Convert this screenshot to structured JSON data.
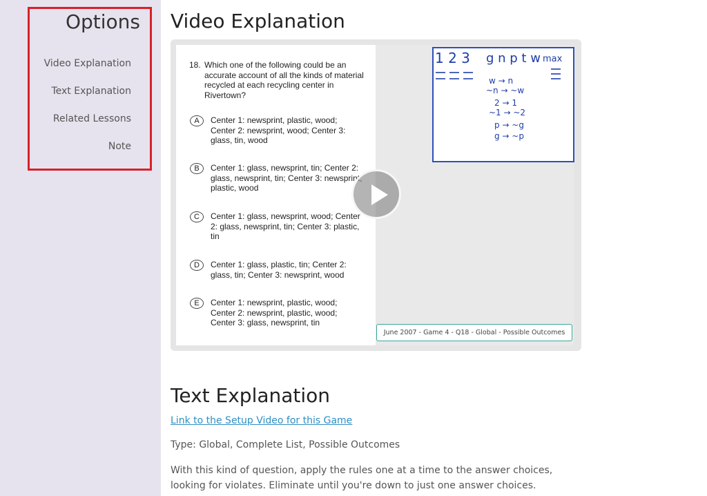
{
  "sidebar": {
    "title": "Options",
    "items": [
      {
        "label": "Video Explanation"
      },
      {
        "label": "Text Explanation"
      },
      {
        "label": "Related Lessons"
      },
      {
        "label": "Note"
      }
    ]
  },
  "video_section": {
    "title": "Video Explanation",
    "question": {
      "number": "18.",
      "stem": "Which one of the following could be an accurate account of all the kinds of material recycled at each recycling center in Rivertown?",
      "choices": [
        {
          "letter": "A",
          "text": "Center 1: newsprint, plastic, wood; Center 2: newsprint, wood; Center 3: glass, tin, wood"
        },
        {
          "letter": "B",
          "text": "Center 1: glass, newsprint, tin; Center 2: glass, newsprint, tin; Center 3: newsprint, plastic, wood"
        },
        {
          "letter": "C",
          "text": "Center 1: glass, newsprint, wood; Center 2: glass, newsprint, tin; Center 3: plastic, tin"
        },
        {
          "letter": "D",
          "text": "Center 1: glass, plastic, tin; Center 2: glass, tin; Center 3: newsprint, wood"
        },
        {
          "letter": "E",
          "text": "Center 1: newsprint, plastic, wood; Center 2: newsprint, plastic, wood; Center 3: glass, newsprint, tin"
        }
      ]
    },
    "whiteboard": {
      "header_numbers": "1 2 3",
      "header_letters": "g n p t w",
      "header_max": "max",
      "rules": [
        "w → n",
        "~n → ~w",
        "2 → 1",
        "~1 → ~2",
        "p → ~g",
        "g → ~p"
      ]
    },
    "caption": "June 2007 - Game 4 - Q18 - Global - Possible Outcomes"
  },
  "text_section": {
    "title": "Text Explanation",
    "link": "Link to the Setup Video for this Game",
    "type_line": "Type: Global, Complete List, Possible Outcomes",
    "body": "With this kind of question, apply the rules one at a time to the answer choices, looking for violates. Eliminate until you're down to just one answer choices."
  },
  "colors": {
    "sidebar_bg": "#e7e3ee",
    "highlight_border": "#d9202a",
    "link": "#2e8fc4",
    "whiteboard_ink": "#1f3da8",
    "caption_border": "#3aa79a"
  }
}
